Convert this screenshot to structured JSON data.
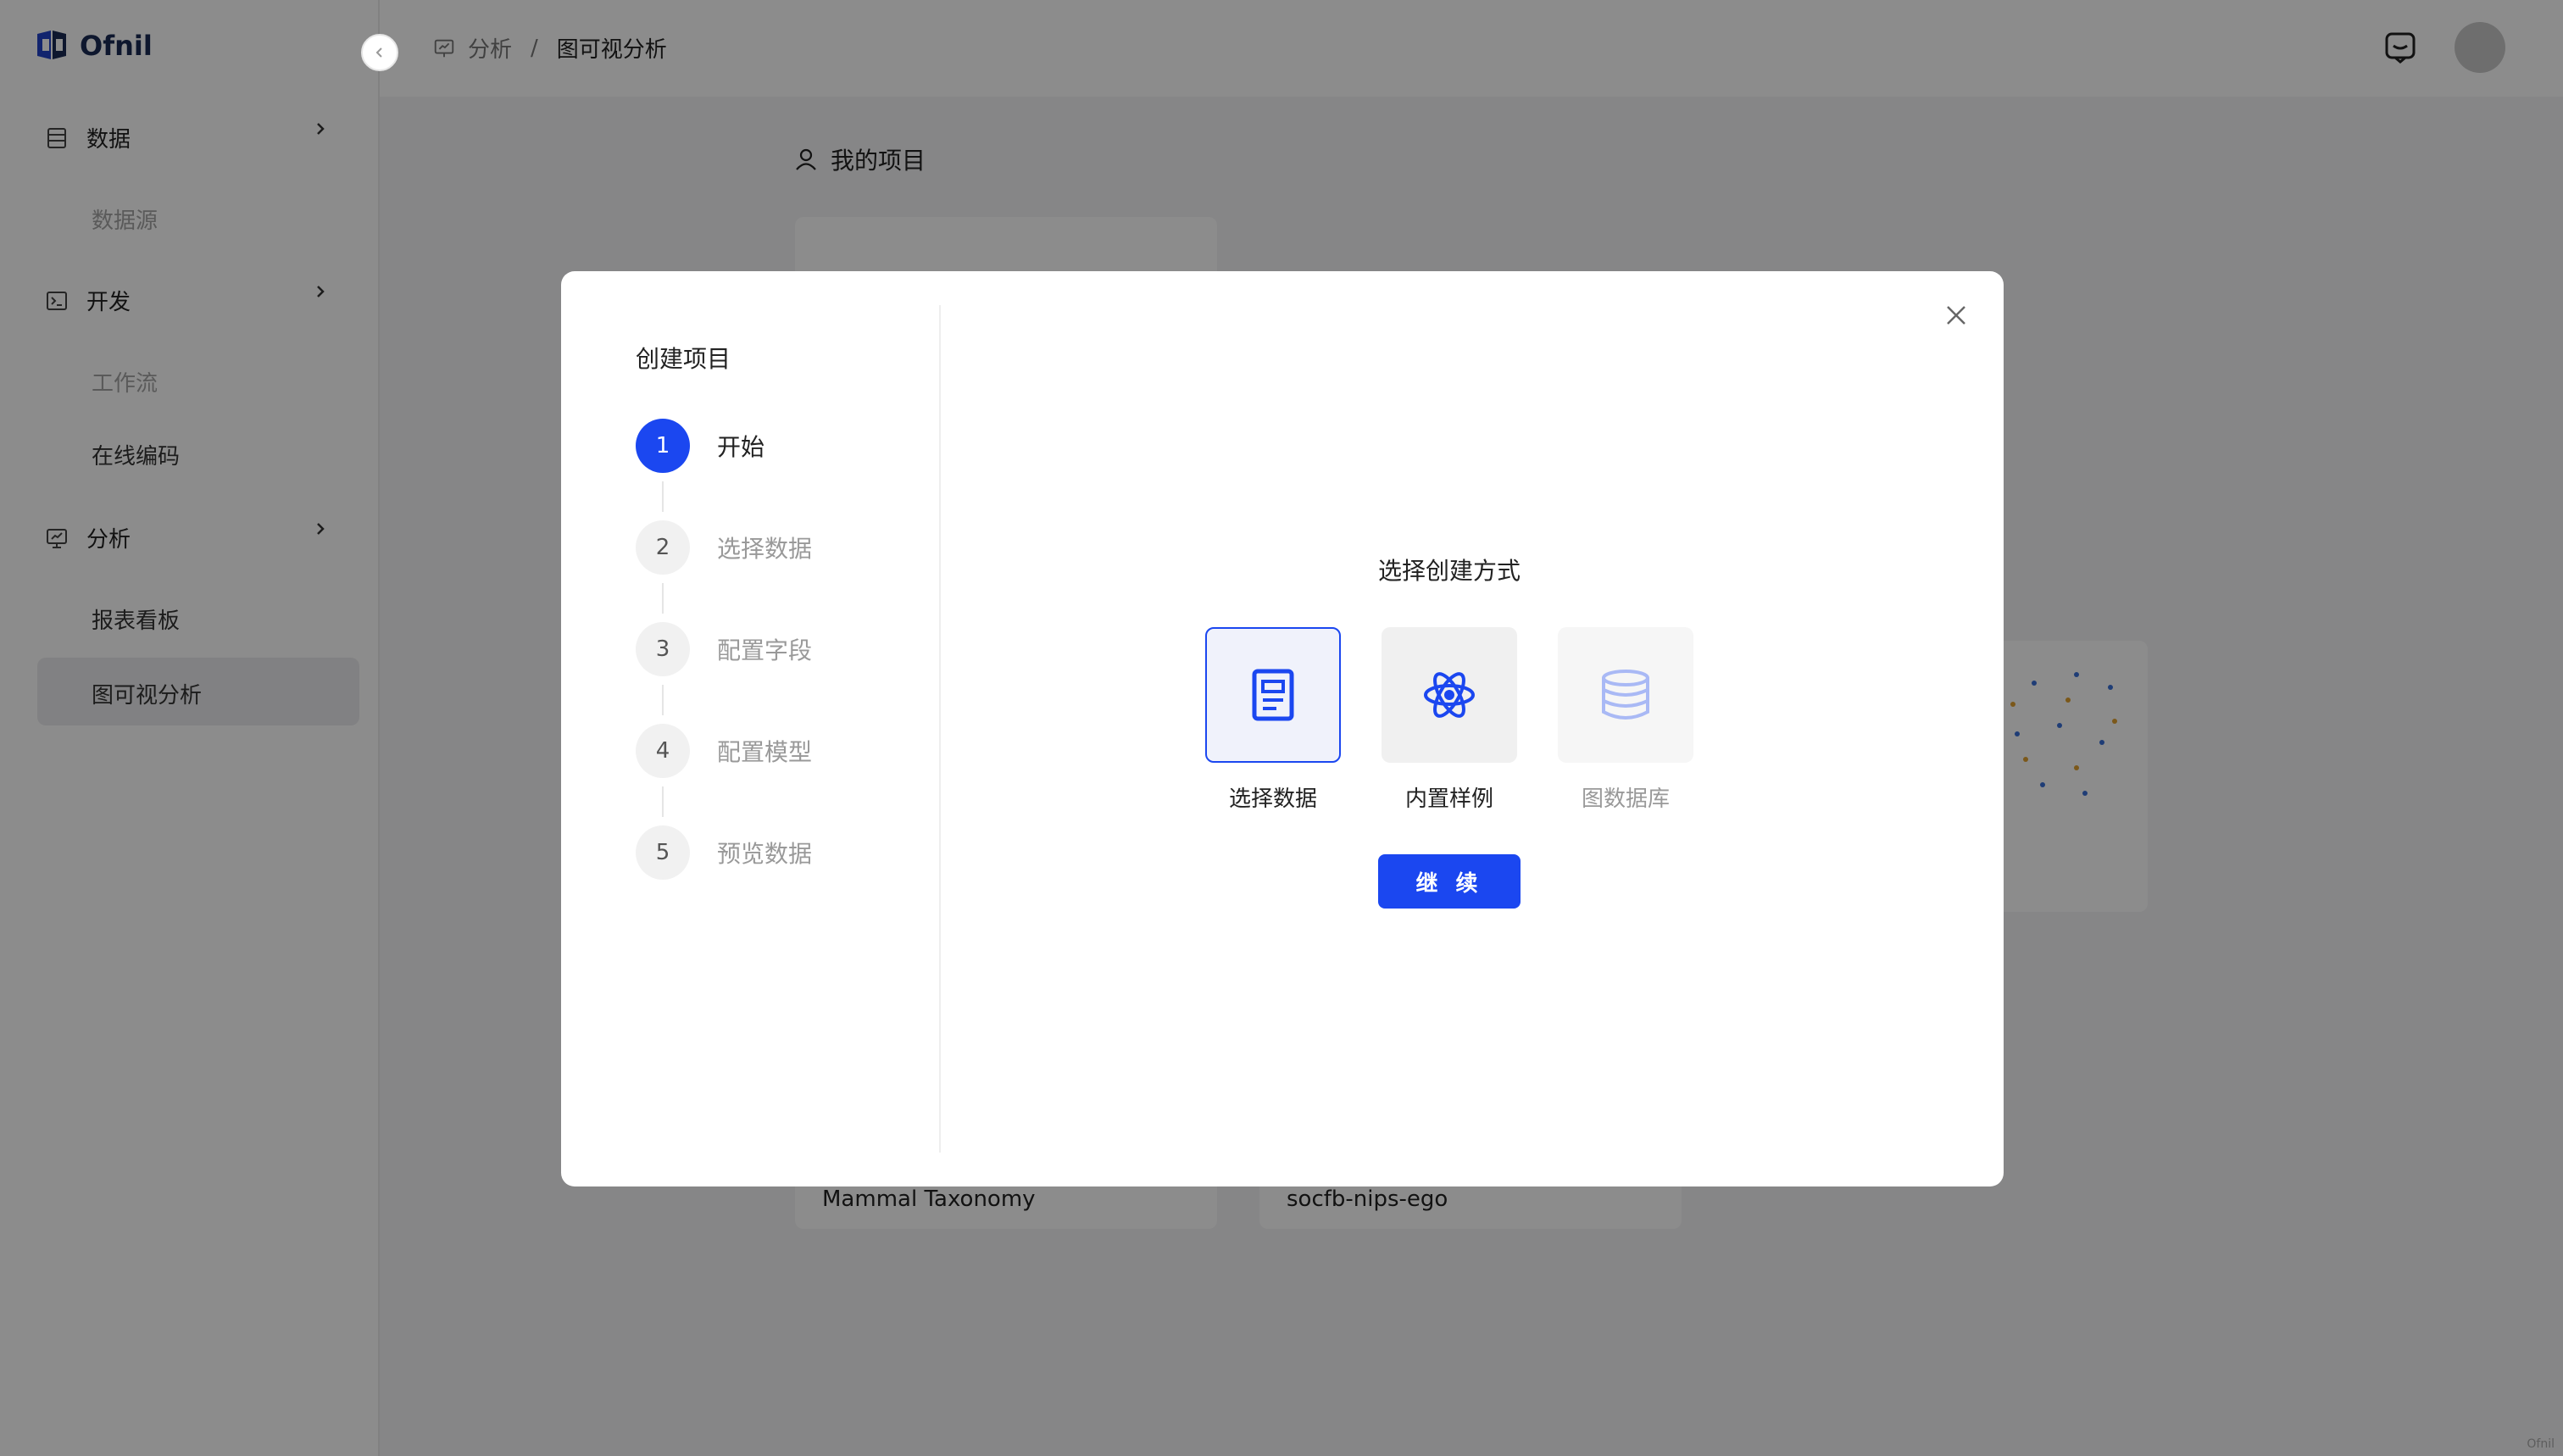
{
  "app": {
    "name": "Ofnil"
  },
  "colors": {
    "accent": "#1b47f0",
    "sidebar_bg": "#ffffff",
    "page_bg": "#f4f4f6"
  },
  "sidebar": {
    "collapse_icon": "chevron-left-icon",
    "groups": [
      {
        "label": "数据",
        "icon": "database-icon",
        "items": [
          {
            "label": "数据源",
            "disabled": true
          }
        ]
      },
      {
        "label": "开发",
        "icon": "terminal-icon",
        "items": [
          {
            "label": "工作流",
            "disabled": true
          },
          {
            "label": "在线编码",
            "disabled": false
          }
        ]
      },
      {
        "label": "分析",
        "icon": "analytics-icon",
        "items": [
          {
            "label": "报表看板",
            "disabled": false
          },
          {
            "label": "图可视分析",
            "active": true
          }
        ]
      }
    ]
  },
  "header": {
    "breadcrumb": [
      {
        "label": "分析",
        "icon": "analytics-icon"
      },
      {
        "label": "图可视分析"
      }
    ],
    "separator": "/",
    "help_icon": "chat-help-icon"
  },
  "main": {
    "section_title": "我的项目",
    "section_icon": "user-icon",
    "projects": [
      {
        "name": "Mammal Taxonomy"
      },
      {
        "name": "socfb-nips-ego"
      }
    ]
  },
  "modal": {
    "steps_title": "创建项目",
    "steps": [
      {
        "number": "1",
        "label": "开始",
        "active": true
      },
      {
        "number": "2",
        "label": "选择数据"
      },
      {
        "number": "3",
        "label": "配置字段"
      },
      {
        "number": "4",
        "label": "配置模型"
      },
      {
        "number": "5",
        "label": "预览数据"
      }
    ],
    "choose_title": "选择创建方式",
    "options": [
      {
        "label": "选择数据",
        "icon": "document-icon",
        "selected": true
      },
      {
        "label": "内置样例",
        "icon": "atom-icon"
      },
      {
        "label": "图数据库",
        "icon": "database-cylinder-icon",
        "disabled": true
      }
    ],
    "continue_label": "继 续"
  },
  "watermark": "Ofnil"
}
